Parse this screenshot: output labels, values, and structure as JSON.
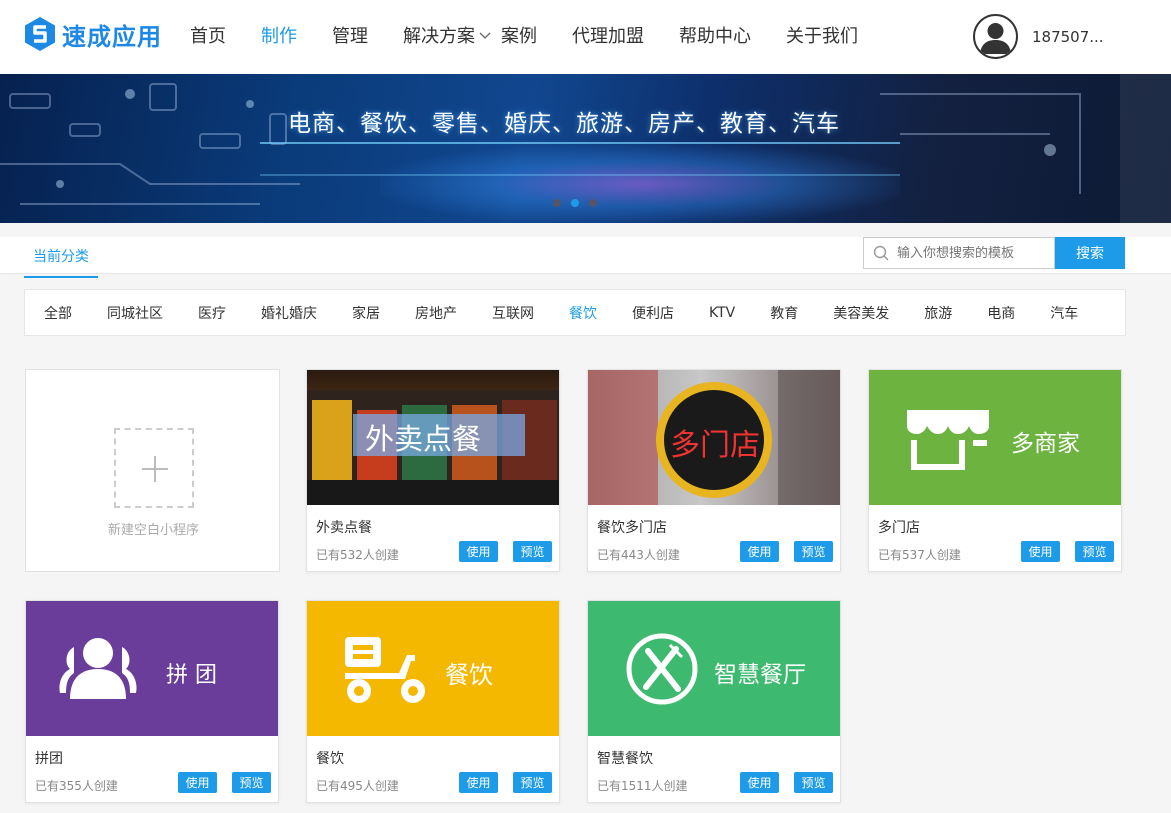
{
  "header": {
    "logo_text": "速成应用",
    "nav": [
      {
        "label": "首页",
        "active": false
      },
      {
        "label": "制作",
        "active": true
      },
      {
        "label": "管理",
        "active": false
      },
      {
        "label": "解决方案",
        "active": false
      },
      {
        "label": "案例",
        "active": false
      },
      {
        "label": "代理加盟",
        "active": false
      },
      {
        "label": "帮助中心",
        "active": false
      },
      {
        "label": "关于我们",
        "active": false
      }
    ],
    "user_name": "187507..."
  },
  "banner": {
    "text": "电商、餐饮、零售、婚庆、旅游、房产、教育、汽车",
    "slides": 3,
    "active_slide": 2
  },
  "category": {
    "title": "当前分类",
    "search_placeholder": "输入你想搜索的模板",
    "search_button": "搜索",
    "filters": [
      "全部",
      "同城社区",
      "医疗",
      "婚礼婚庆",
      "家居",
      "房地产",
      "互联网",
      "餐饮",
      "便利店",
      "KTV",
      "教育",
      "美容美发",
      "旅游",
      "电商",
      "汽车"
    ],
    "active_filter": "餐饮"
  },
  "new_card": {
    "label": "新建空白小程序"
  },
  "buttons": {
    "use": "使用",
    "preview": "预览"
  },
  "templates": [
    {
      "name": "外卖点餐",
      "count": "已有532人创建",
      "image_text": "外卖点餐",
      "color": "#3a2a1e"
    },
    {
      "name": "餐饮多门店",
      "count": "已有443人创建",
      "image_text": "多门店",
      "color": "#8a8a8a"
    },
    {
      "name": "多门店",
      "count": "已有537人创建",
      "image_text": "多商家",
      "color": "#6db33f"
    },
    {
      "name": "拼团",
      "count": "已有355人创建",
      "image_text": "拼 团",
      "color": "#6a3d9a"
    },
    {
      "name": "餐饮",
      "count": "已有495人创建",
      "image_text": "餐饮",
      "color": "#f5b800"
    },
    {
      "name": "智慧餐饮",
      "count": "已有1511人创建",
      "image_text": "智慧餐厅",
      "color": "#3dba6f"
    }
  ]
}
